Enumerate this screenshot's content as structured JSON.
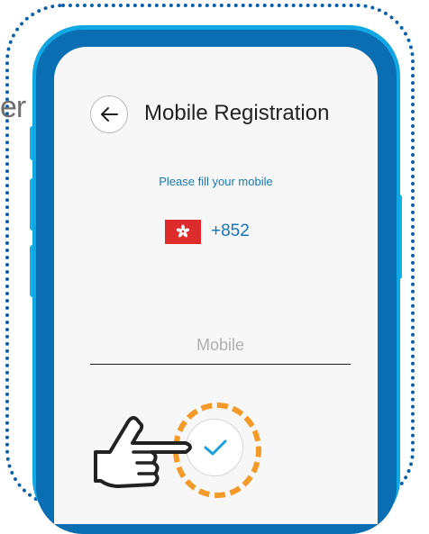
{
  "background_text": "er",
  "header": {
    "back_icon": "arrow-left-icon",
    "title": "Mobile Registration"
  },
  "form": {
    "instruction": "Please fill your mobile",
    "country": {
      "flag_icon": "hong-kong-flag-icon",
      "dial_code": "+852"
    },
    "mobile_placeholder": "Mobile",
    "mobile_value": "",
    "confirm_icon": "checkmark-icon"
  },
  "overlay": {
    "pointer_icon": "pointing-hand-icon",
    "highlight_color": "#f39a28"
  },
  "colors": {
    "accent": "#1575b8",
    "phone_frame": "#0a6eb3",
    "phone_edge": "#11a7e3",
    "flag_red": "#de2b2b"
  }
}
